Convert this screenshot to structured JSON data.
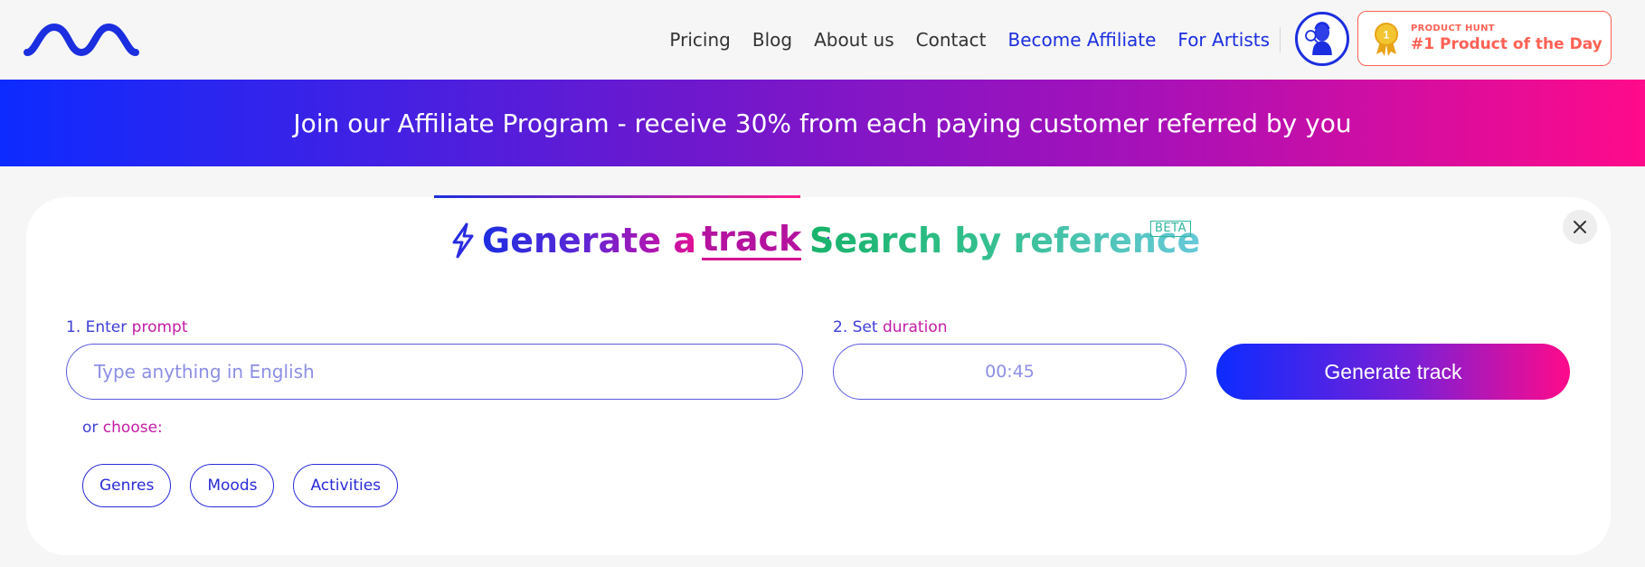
{
  "header": {
    "logo_name": "brand-logo",
    "nav": [
      {
        "label": "Pricing",
        "accent": false
      },
      {
        "label": "Blog",
        "accent": false
      },
      {
        "label": "About us",
        "accent": false
      },
      {
        "label": "Contact",
        "accent": false
      },
      {
        "label": "Become Affiliate",
        "accent": true
      },
      {
        "label": "For Artists",
        "accent": true
      }
    ],
    "product_hunt": {
      "small": "PRODUCT HUNT",
      "big": "#1 Product of the Day",
      "medal_number": "1"
    }
  },
  "banner": {
    "text": "Join our Affiliate Program - receive 30% from each paying customer referred by you"
  },
  "tabs": {
    "generate_prefix": "Generate a",
    "generate_word": "track",
    "search": "Search by reference",
    "beta": "BETA"
  },
  "form": {
    "prompt_label_num": "1. Enter",
    "prompt_label_word": "prompt",
    "prompt_placeholder": "Type anything in English",
    "prompt_value": "",
    "duration_label_num": "2. Set",
    "duration_label_word": "duration",
    "duration_value": "00:45",
    "generate_button": "Generate track",
    "or_label": "or",
    "choose_label": "choose:",
    "chips": [
      "Genres",
      "Moods",
      "Activities"
    ]
  },
  "colors": {
    "brand_blue": "#1b2ee0",
    "brand_pink": "#ff0a8a",
    "product_hunt": "#ff6154",
    "search_green": "#18b36b"
  }
}
